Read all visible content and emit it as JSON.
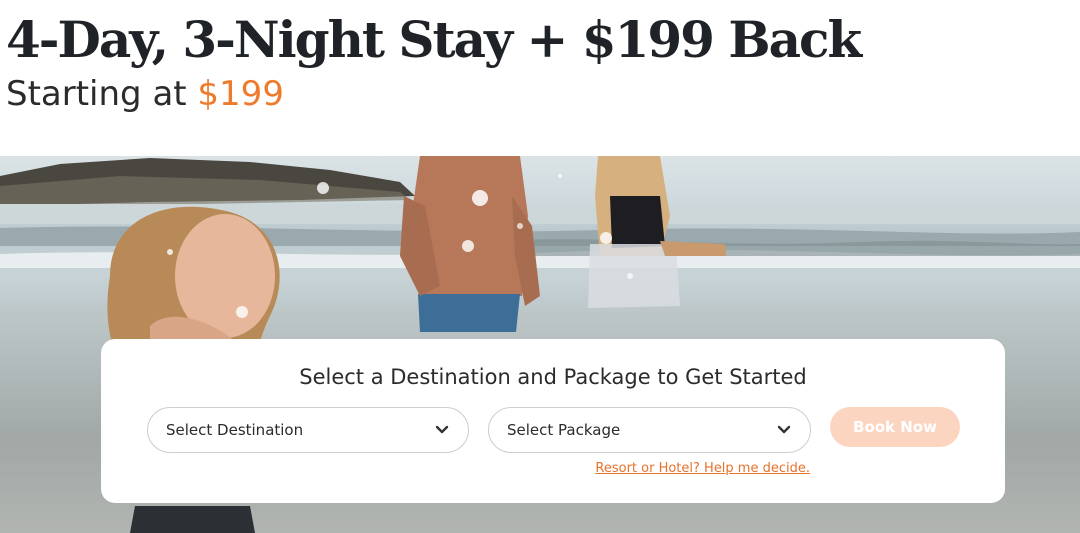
{
  "headline": "4-Day, 3-Night Stay + $199 Back",
  "subhead": {
    "prefix": "Starting at ",
    "price": "$199"
  },
  "booking": {
    "title": "Select a Destination and Package to Get Started",
    "destination_placeholder": "Select Destination",
    "package_placeholder": "Select Package",
    "book_label": "Book Now",
    "help_link": "Resort or Hotel? Help me decide."
  },
  "colors": {
    "accent": "#ef7a2b",
    "button_disabled": "#fcd5c0",
    "link": "#e6722c",
    "text": "#2b2b2b"
  },
  "icons": {
    "dropdown": "chevron-down-icon"
  }
}
